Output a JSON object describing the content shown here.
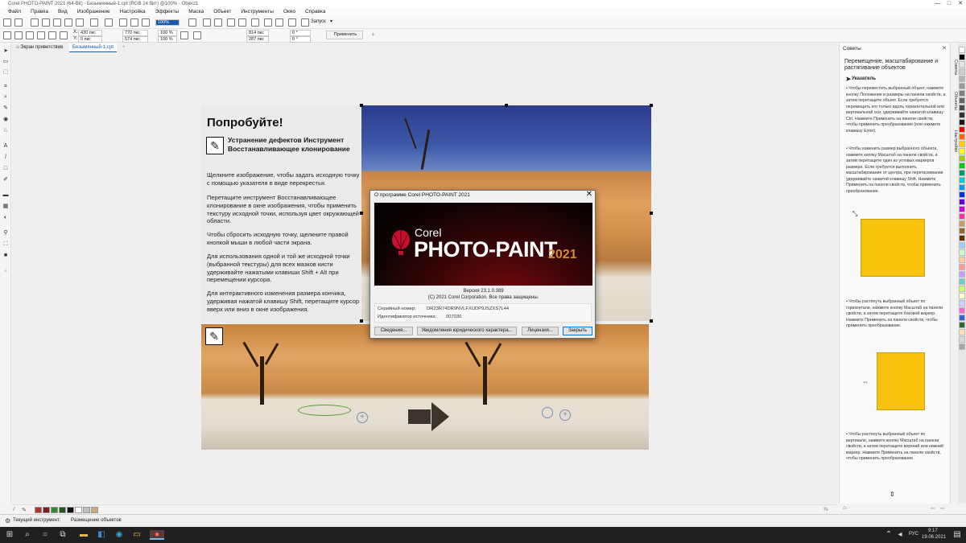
{
  "window": {
    "title": "Corel PHOTO-PAINT 2021 (64-Bit) - Безымянный-1.cpt (RGB 24 бит) @100% - Object1",
    "controls": [
      "—",
      "□",
      "✕"
    ]
  },
  "menu": [
    "Файл",
    "Правка",
    "Вид",
    "Изображение",
    "Настройка",
    "Эффекты",
    "Маска",
    "Объект",
    "Инструменты",
    "Окно",
    "Справка"
  ],
  "toolbar1": {
    "zoom": "100%",
    "launch": "Запуск"
  },
  "toolbar2": {
    "x_label": "X:",
    "x_value": "430 пкс",
    "y_label": "Y:",
    "y_value": "0 пкс",
    "width_value": "770 пкс",
    "height_value": "574 пкс",
    "scale_w": "100 %",
    "scale_h": "100 %",
    "pos_w": "814 пкс",
    "pos_h": "287 пкс",
    "angle1": "0 °",
    "angle2": "0 °",
    "apply_label": "Применить"
  },
  "tabs": [
    {
      "label": "Экран приветствия"
    },
    {
      "label": "Безымянный-1.cpt"
    }
  ],
  "hint": {
    "title": "Попробуйте!",
    "subtitle": "Устранение дефектов Инструмент Восстанавливающее клонирование",
    "p1": "Щелкните изображение, чтобы задать исходную точку с помощью указателя в виде перекрестья.",
    "p2": "Перетащите инструмент Восстанавливающее клонирование в окне изображения, чтобы применить текстуру исходной точки, используя цвет окружающей области.",
    "p3": "Чтобы сбросить исходную точку, щелкните правой кнопкой мыши в любой части экрана.",
    "p4": "Для использования одной и той же исходной точки (выбранной текстуры) для всех мазков кисти удерживайте нажатыми клавиши Shift + Alt при перемещении курсора.",
    "p5": "Для интерактивного изменения размера кончика, удерживая нажатой клавишу Shift, перетащите курсор вверх или вниз в окне изображения."
  },
  "about": {
    "title": "О программе Corel PHOTO-PAINT 2021",
    "brand": "Corel",
    "product": "PHOTO-PAINT",
    "year": "2021",
    "version": "Версия 23.1.0.389",
    "copyright": "(C) 2021 Corel Corporation.  Все права защищены.",
    "serial_label": "Серийный номер:",
    "serial_value": "DR23R74DR9NVLFXUDP9JSZXS7L44",
    "source_label": "Идентификатор источника:",
    "source_value": "007030",
    "buttons": [
      "Сведения...",
      "Уведомления юридического характера...",
      "Лицензия...",
      "Закрыть"
    ]
  },
  "tips": {
    "header": "Советы",
    "title": "Перемещение, масштабирование и растягивание объектов",
    "section": "Указатель",
    "p1": "• Чтобы переместить выбранный объект, нажмите кнопку Положение и размеры на панели свойств, а затем перетащите объект. Если требуется перемещать его только вдоль горизонтальной или вертикальной оси, удерживайте нажатой клавишу Ctrl. Нажмите Применить на панели свойств, чтобы применить преобразование (или нажмите клавишу Enter).",
    "p2": "• Чтобы изменить размер выбранного объекта, нажмите кнопку Масштаб на панели свойств, а затем перетащите один из угловых маркеров размера. Если требуется выполнить масштабирование от центра, при перетаскивании удерживайте нажатой клавишу Shift. Нажмите Применить на панели свойств, чтобы применить преобразование.",
    "p3": "• Чтобы растянуть выбранный объект по горизонтали, нажмите кнопку Масштаб на панели свойств, а затем перетащите боковой маркер. Нажмите Применить на панели свойств, чтобы применить преобразование.",
    "p4": "• Чтобы растянуть выбранный объект по вертикали, нажмите кнопку Масштаб на панели свойств, а затем перетащите верхний или нижний маркер. Нажмите Применить на панели свойств, чтобы применить преобразование."
  },
  "side_tabs": [
    "Советы",
    "Объекты",
    "Настройки"
  ],
  "palette_colors": [
    "#ffffff",
    "#000000",
    "#e6e6e6",
    "#cccccc",
    "#b3b3b3",
    "#999999",
    "#808080",
    "#666666",
    "#4d4d4d",
    "#333333",
    "#1a1a1a",
    "#ff0000",
    "#ff6600",
    "#ffcc00",
    "#ffff00",
    "#99cc00",
    "#00cc00",
    "#009966",
    "#00cccc",
    "#0099ff",
    "#0033cc",
    "#6600cc",
    "#cc00cc",
    "#ff3399",
    "#cc9966",
    "#996633",
    "#663300",
    "#99ccff",
    "#ccffcc",
    "#ffcc99",
    "#ff9999",
    "#cc99ff",
    "#66cccc",
    "#ccff66",
    "#ffffcc",
    "#ccccff",
    "#ff66cc",
    "#3366cc",
    "#336633",
    "#ffe0b3",
    "#d9d9d9",
    "#a6a6a6"
  ],
  "bottom_colors": [
    "#b23030",
    "#7a2020",
    "#2e8b2e",
    "#1d5a1d",
    "#101010",
    "#ffffff",
    "#bfbfbf",
    "#c9a87a"
  ],
  "status": {
    "tool_label": "Текущий инструмент:",
    "tool_value": "Размещение объектов"
  },
  "taskbar": {
    "lang": "РУС",
    "time": "9:17",
    "date": "19.06.2021"
  }
}
